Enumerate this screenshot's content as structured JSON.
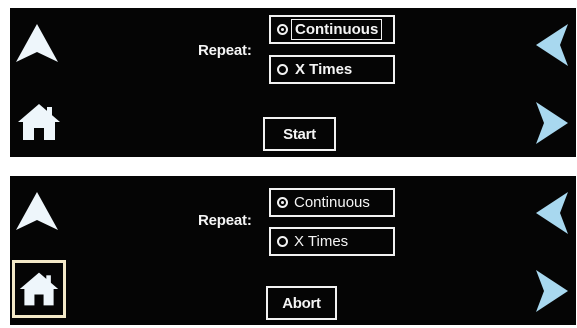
{
  "colors": {
    "background": "#050505",
    "foreground": "#f2f2f2",
    "arrow_side": "#a8d8ef",
    "arrow_up": "#eef6fb"
  },
  "screens": [
    {
      "repeat_label": "Repeat:",
      "options": [
        {
          "label": "Continuous",
          "selected": true
        },
        {
          "label": "X Times",
          "selected": false
        }
      ],
      "action_label": "Start",
      "icons": [
        "up-arrow-icon",
        "home-icon",
        "left-arrow-icon",
        "right-arrow-icon"
      ]
    },
    {
      "repeat_label": "Repeat:",
      "options": [
        {
          "label": "Continuous",
          "selected": true
        },
        {
          "label": "X Times",
          "selected": false
        }
      ],
      "action_label": "Abort",
      "home_highlighted": true,
      "icons": [
        "up-arrow-icon",
        "home-icon",
        "left-arrow-icon",
        "right-arrow-icon"
      ]
    }
  ]
}
